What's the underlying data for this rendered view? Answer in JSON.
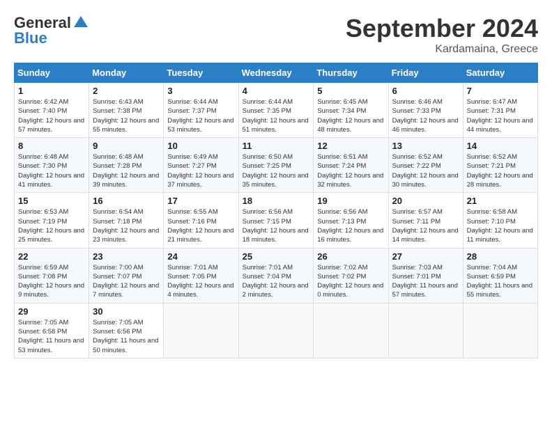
{
  "header": {
    "logo_general": "General",
    "logo_blue": "Blue",
    "month": "September 2024",
    "location": "Kardamaina, Greece"
  },
  "weekdays": [
    "Sunday",
    "Monday",
    "Tuesday",
    "Wednesday",
    "Thursday",
    "Friday",
    "Saturday"
  ],
  "weeks": [
    [
      {
        "day": "1",
        "sunrise": "6:42 AM",
        "sunset": "7:40 PM",
        "daylight": "12 hours and 57 minutes."
      },
      {
        "day": "2",
        "sunrise": "6:43 AM",
        "sunset": "7:38 PM",
        "daylight": "12 hours and 55 minutes."
      },
      {
        "day": "3",
        "sunrise": "6:44 AM",
        "sunset": "7:37 PM",
        "daylight": "12 hours and 53 minutes."
      },
      {
        "day": "4",
        "sunrise": "6:44 AM",
        "sunset": "7:35 PM",
        "daylight": "12 hours and 51 minutes."
      },
      {
        "day": "5",
        "sunrise": "6:45 AM",
        "sunset": "7:34 PM",
        "daylight": "12 hours and 48 minutes."
      },
      {
        "day": "6",
        "sunrise": "6:46 AM",
        "sunset": "7:33 PM",
        "daylight": "12 hours and 46 minutes."
      },
      {
        "day": "7",
        "sunrise": "6:47 AM",
        "sunset": "7:31 PM",
        "daylight": "12 hours and 44 minutes."
      }
    ],
    [
      {
        "day": "8",
        "sunrise": "6:48 AM",
        "sunset": "7:30 PM",
        "daylight": "12 hours and 41 minutes."
      },
      {
        "day": "9",
        "sunrise": "6:48 AM",
        "sunset": "7:28 PM",
        "daylight": "12 hours and 39 minutes."
      },
      {
        "day": "10",
        "sunrise": "6:49 AM",
        "sunset": "7:27 PM",
        "daylight": "12 hours and 37 minutes."
      },
      {
        "day": "11",
        "sunrise": "6:50 AM",
        "sunset": "7:25 PM",
        "daylight": "12 hours and 35 minutes."
      },
      {
        "day": "12",
        "sunrise": "6:51 AM",
        "sunset": "7:24 PM",
        "daylight": "12 hours and 32 minutes."
      },
      {
        "day": "13",
        "sunrise": "6:52 AM",
        "sunset": "7:22 PM",
        "daylight": "12 hours and 30 minutes."
      },
      {
        "day": "14",
        "sunrise": "6:52 AM",
        "sunset": "7:21 PM",
        "daylight": "12 hours and 28 minutes."
      }
    ],
    [
      {
        "day": "15",
        "sunrise": "6:53 AM",
        "sunset": "7:19 PM",
        "daylight": "12 hours and 25 minutes."
      },
      {
        "day": "16",
        "sunrise": "6:54 AM",
        "sunset": "7:18 PM",
        "daylight": "12 hours and 23 minutes."
      },
      {
        "day": "17",
        "sunrise": "6:55 AM",
        "sunset": "7:16 PM",
        "daylight": "12 hours and 21 minutes."
      },
      {
        "day": "18",
        "sunrise": "6:56 AM",
        "sunset": "7:15 PM",
        "daylight": "12 hours and 18 minutes."
      },
      {
        "day": "19",
        "sunrise": "6:56 AM",
        "sunset": "7:13 PM",
        "daylight": "12 hours and 16 minutes."
      },
      {
        "day": "20",
        "sunrise": "6:57 AM",
        "sunset": "7:11 PM",
        "daylight": "12 hours and 14 minutes."
      },
      {
        "day": "21",
        "sunrise": "6:58 AM",
        "sunset": "7:10 PM",
        "daylight": "12 hours and 11 minutes."
      }
    ],
    [
      {
        "day": "22",
        "sunrise": "6:59 AM",
        "sunset": "7:08 PM",
        "daylight": "12 hours and 9 minutes."
      },
      {
        "day": "23",
        "sunrise": "7:00 AM",
        "sunset": "7:07 PM",
        "daylight": "12 hours and 7 minutes."
      },
      {
        "day": "24",
        "sunrise": "7:01 AM",
        "sunset": "7:05 PM",
        "daylight": "12 hours and 4 minutes."
      },
      {
        "day": "25",
        "sunrise": "7:01 AM",
        "sunset": "7:04 PM",
        "daylight": "12 hours and 2 minutes."
      },
      {
        "day": "26",
        "sunrise": "7:02 AM",
        "sunset": "7:02 PM",
        "daylight": "12 hours and 0 minutes."
      },
      {
        "day": "27",
        "sunrise": "7:03 AM",
        "sunset": "7:01 PM",
        "daylight": "11 hours and 57 minutes."
      },
      {
        "day": "28",
        "sunrise": "7:04 AM",
        "sunset": "6:59 PM",
        "daylight": "11 hours and 55 minutes."
      }
    ],
    [
      {
        "day": "29",
        "sunrise": "7:05 AM",
        "sunset": "6:58 PM",
        "daylight": "11 hours and 53 minutes."
      },
      {
        "day": "30",
        "sunrise": "7:05 AM",
        "sunset": "6:56 PM",
        "daylight": "11 hours and 50 minutes."
      },
      null,
      null,
      null,
      null,
      null
    ]
  ]
}
